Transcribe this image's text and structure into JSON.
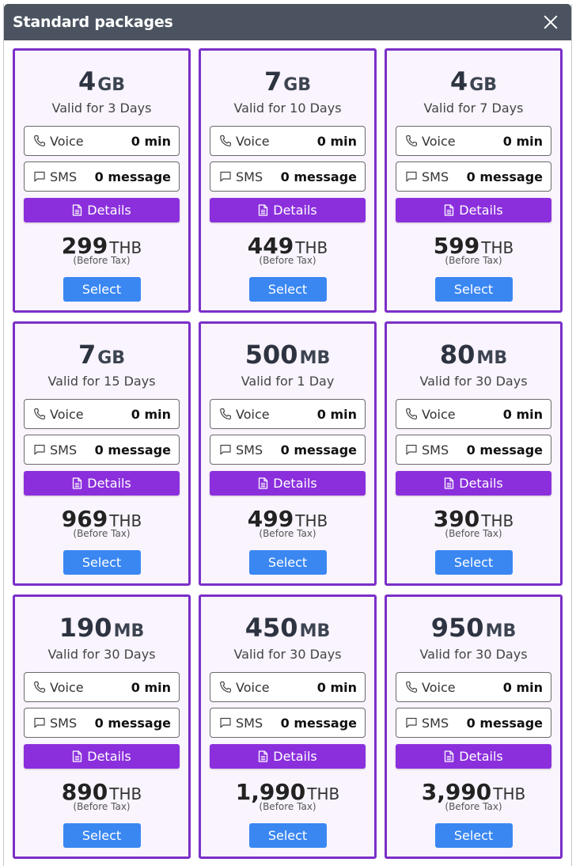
{
  "header": {
    "title": "Standard packages"
  },
  "packages": [
    {
      "amount": "4",
      "unit": "GB",
      "validity": "Valid for 3 Days",
      "voice_label": "Voice",
      "voice_value": "0 min",
      "sms_label": "SMS",
      "sms_value": "0 message",
      "details_label": "Details",
      "price": "299",
      "currency": "THB",
      "tax_note": "(Before Tax)",
      "select_label": "Select"
    },
    {
      "amount": "7",
      "unit": "GB",
      "validity": "Valid for 10 Days",
      "voice_label": "Voice",
      "voice_value": "0 min",
      "sms_label": "SMS",
      "sms_value": "0 message",
      "details_label": "Details",
      "price": "449",
      "currency": "THB",
      "tax_note": "(Before Tax)",
      "select_label": "Select"
    },
    {
      "amount": "4",
      "unit": "GB",
      "validity": "Valid for 7 Days",
      "voice_label": "Voice",
      "voice_value": "0 min",
      "sms_label": "SMS",
      "sms_value": "0 message",
      "details_label": "Details",
      "price": "599",
      "currency": "THB",
      "tax_note": "(Before Tax)",
      "select_label": "Select"
    },
    {
      "amount": "7",
      "unit": "GB",
      "validity": "Valid for 15 Days",
      "voice_label": "Voice",
      "voice_value": "0 min",
      "sms_label": "SMS",
      "sms_value": "0 message",
      "details_label": "Details",
      "price": "969",
      "currency": "THB",
      "tax_note": "(Before Tax)",
      "select_label": "Select"
    },
    {
      "amount": "500",
      "unit": "MB",
      "validity": "Valid for 1 Day",
      "voice_label": "Voice",
      "voice_value": "0 min",
      "sms_label": "SMS",
      "sms_value": "0 message",
      "details_label": "Details",
      "price": "499",
      "currency": "THB",
      "tax_note": "(Before Tax)",
      "select_label": "Select"
    },
    {
      "amount": "80",
      "unit": "MB",
      "validity": "Valid for 30 Days",
      "voice_label": "Voice",
      "voice_value": "0 min",
      "sms_label": "SMS",
      "sms_value": "0 message",
      "details_label": "Details",
      "price": "390",
      "currency": "THB",
      "tax_note": "(Before Tax)",
      "select_label": "Select"
    },
    {
      "amount": "190",
      "unit": "MB",
      "validity": "Valid for 30 Days",
      "voice_label": "Voice",
      "voice_value": "0 min",
      "sms_label": "SMS",
      "sms_value": "0 message",
      "details_label": "Details",
      "price": "890",
      "currency": "THB",
      "tax_note": "(Before Tax)",
      "select_label": "Select"
    },
    {
      "amount": "450",
      "unit": "MB",
      "validity": "Valid for 30 Days",
      "voice_label": "Voice",
      "voice_value": "0 min",
      "sms_label": "SMS",
      "sms_value": "0 message",
      "details_label": "Details",
      "price": "1,990",
      "currency": "THB",
      "tax_note": "(Before Tax)",
      "select_label": "Select"
    },
    {
      "amount": "950",
      "unit": "MB",
      "validity": "Valid for 30 Days",
      "voice_label": "Voice",
      "voice_value": "0 min",
      "sms_label": "SMS",
      "sms_value": "0 message",
      "details_label": "Details",
      "price": "3,990",
      "currency": "THB",
      "tax_note": "(Before Tax)",
      "select_label": "Select"
    }
  ],
  "icons": {
    "close": "close-icon",
    "voice": "phone-icon",
    "sms": "message-icon",
    "details": "document-icon"
  },
  "colors": {
    "header_bg": "#4b5360",
    "card_border": "#7b2fc8",
    "card_bg": "#f9f4fd",
    "details_button": "#8b2fdd",
    "select_button": "#3a87f2"
  }
}
